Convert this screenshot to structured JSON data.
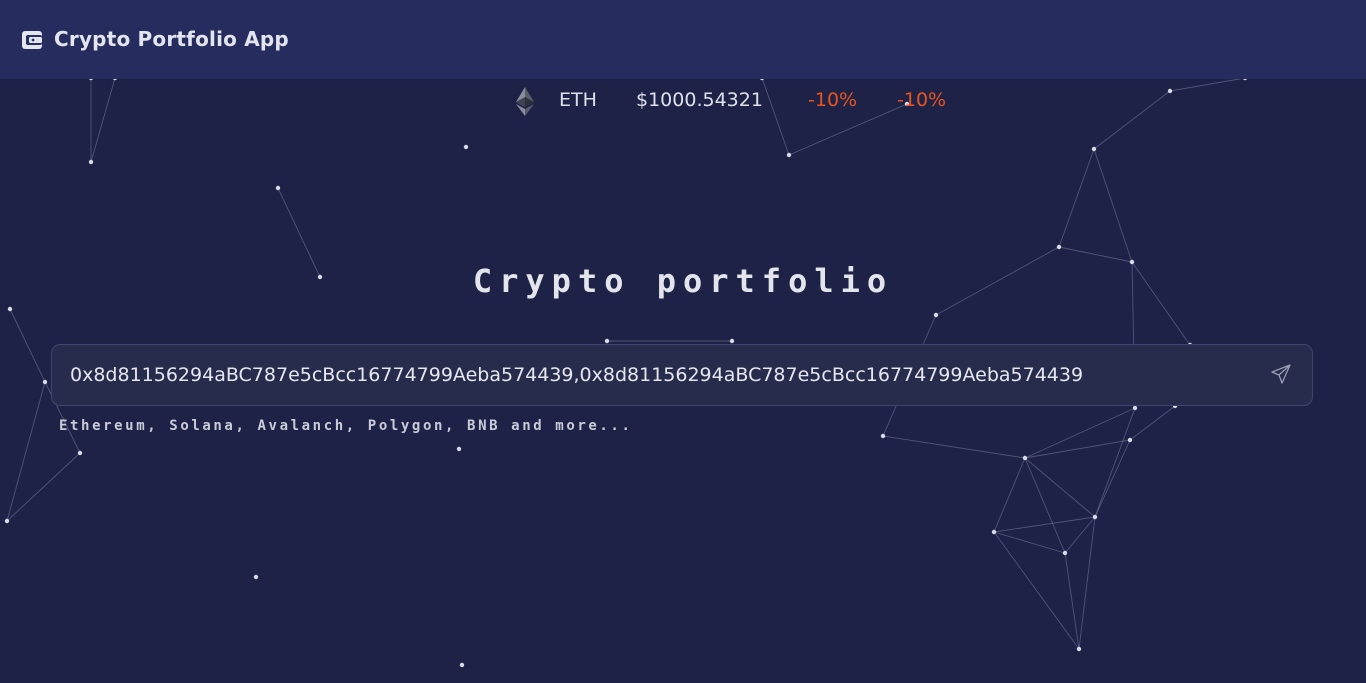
{
  "app": {
    "title": "Crypto Portfolio App",
    "logo_icon": "wallet-icon"
  },
  "ticker": {
    "icon": "ethereum-icon",
    "symbol": "ETH",
    "price": "$1000.54321",
    "change_1": "-10%",
    "change_2": "-10%",
    "change_color": "#e8541e"
  },
  "main": {
    "title": "Crypto portfolio",
    "search": {
      "value": "0x8d81156294aBC787e5cBcc16774799Aeba574439,0x8d81156294aBC787e5cBcc16774799Aeba574439",
      "send_icon": "send-icon"
    },
    "hint": "Ethereum, Solana, Avalanch, Polygon, BNB and more..."
  },
  "colors": {
    "background": "#1e2246",
    "header": "#262d5e",
    "input_bg": "#272b4c"
  }
}
